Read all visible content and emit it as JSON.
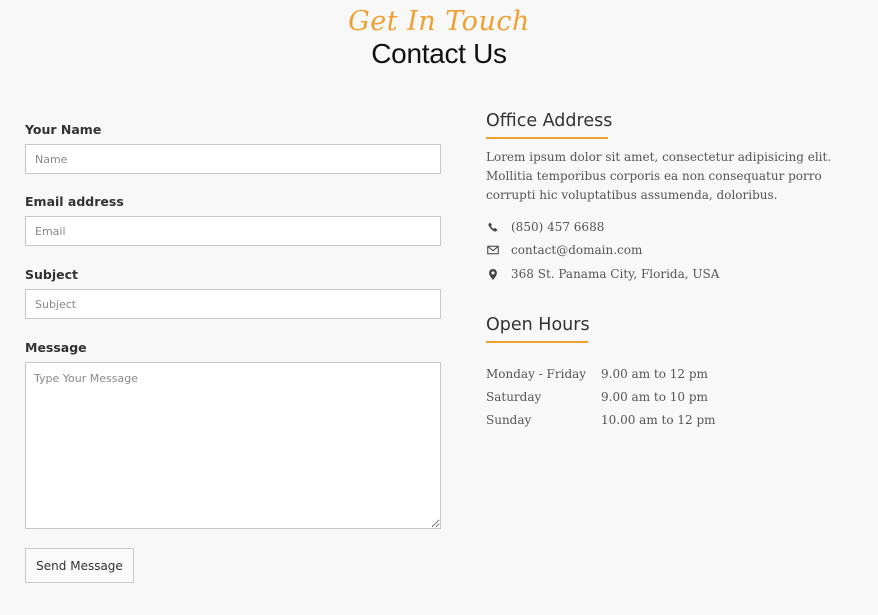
{
  "heading": {
    "tagline": "Get In Touch",
    "title": "Contact Us"
  },
  "form": {
    "name_label": "Your Name",
    "name_placeholder": "Name",
    "email_label": "Email address",
    "email_placeholder": "Email",
    "subject_label": "Subject",
    "subject_placeholder": "Subject",
    "message_label": "Message",
    "message_placeholder": "Type Your Message",
    "submit_label": "Send Message"
  },
  "office": {
    "title": "Office Address",
    "description": "Lorem ipsum dolor sit amet, consectetur adipisicing elit. Mollitia temporibus corporis ea non consequatur porro corrupti hic voluptatibus assumenda, doloribus.",
    "contacts": [
      {
        "icon": "phone-icon",
        "text": "(850) 457 6688"
      },
      {
        "icon": "envelope-icon",
        "text": "contact@domain.com"
      },
      {
        "icon": "map-marker-icon",
        "text": "368 St. Panama City, Florida, USA"
      }
    ]
  },
  "hours": {
    "title": "Open Hours",
    "rows": [
      {
        "day": "Monday - Friday",
        "time": "9.00 am to 12 pm"
      },
      {
        "day": "Saturday",
        "time": "9.00 am to 10 pm"
      },
      {
        "day": "Sunday",
        "time": "10.00 am to 12 pm"
      }
    ]
  },
  "colors": {
    "accent": "#f0a030",
    "background": "#f8f8f8",
    "title_text": "#111111",
    "body_text": "#555555",
    "input_border": "#c8c8c8"
  }
}
